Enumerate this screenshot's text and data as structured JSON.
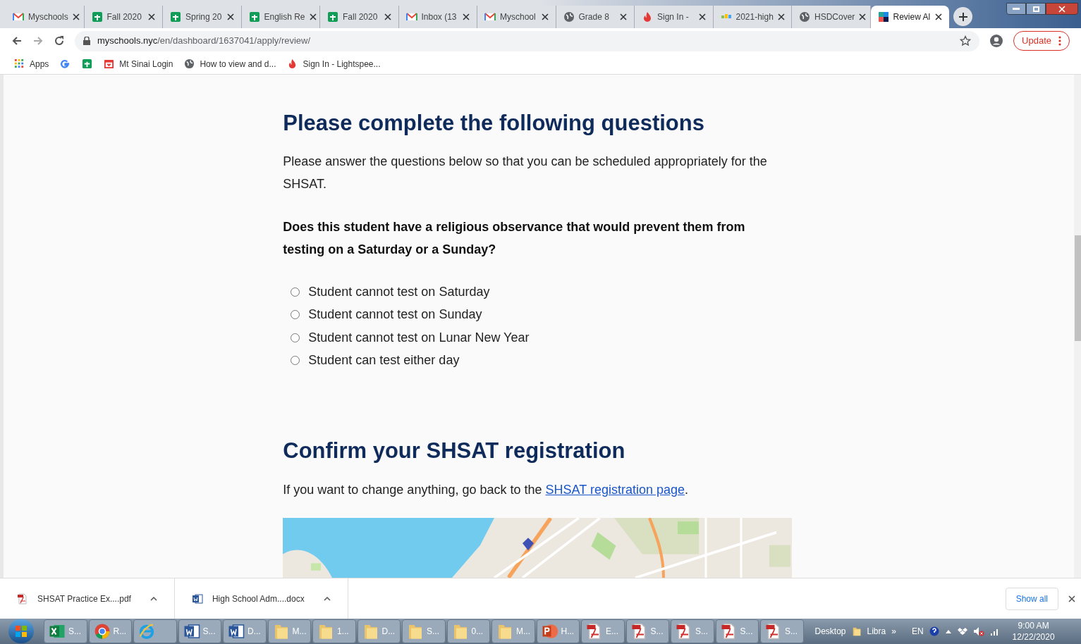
{
  "tabs": [
    {
      "kind": "gmail",
      "label": "Myschools",
      "selected": false
    },
    {
      "kind": "sheets",
      "label": "Fall 2020",
      "selected": false
    },
    {
      "kind": "sheets",
      "label": "Spring 20",
      "selected": false
    },
    {
      "kind": "sheets",
      "label": "English Re",
      "selected": false
    },
    {
      "kind": "sheets",
      "label": "Fall 2020",
      "selected": false
    },
    {
      "kind": "gmail",
      "label": "Inbox (13",
      "selected": false
    },
    {
      "kind": "gmail",
      "label": "Myschool",
      "selected": false
    },
    {
      "kind": "globe",
      "label": "Grade 8",
      "selected": false
    },
    {
      "kind": "flame",
      "label": "Sign In -",
      "selected": false
    },
    {
      "kind": "chart",
      "label": "2021-high",
      "selected": false
    },
    {
      "kind": "globe",
      "label": "HSDCover",
      "selected": false
    },
    {
      "kind": "squares",
      "label": "Review Al",
      "selected": true
    }
  ],
  "address_bar": {
    "domain": "myschools.nyc",
    "path": "/en/dashboard/1637041/apply/review/"
  },
  "update_button": "Update",
  "bookmarks": [
    {
      "kind": "apps",
      "label": "Apps"
    },
    {
      "kind": "google"
    },
    {
      "kind": "sheets"
    },
    {
      "kind": "calendar",
      "label": "Mt Sinai Login"
    },
    {
      "kind": "globe",
      "label": "How to view and d..."
    },
    {
      "kind": "flame",
      "label": "Sign In - Lightspee..."
    }
  ],
  "questions": {
    "heading": "Please complete the following questions",
    "intro": "Please answer the questions below so that you can be scheduled appropriately for the SHSAT.",
    "question": "Does this student have a religious observance that would prevent them from testing on a Saturday or a Sunday?",
    "options": [
      {
        "label": "Student cannot test on Saturday",
        "selected": false
      },
      {
        "label": "Student cannot test on Sunday",
        "selected": false
      },
      {
        "label": "Student cannot test on Lunar New Year",
        "selected": false
      },
      {
        "label": "Student can test either day",
        "selected": false
      }
    ]
  },
  "confirm": {
    "heading": "Confirm your SHSAT registration",
    "text_before": "If you want to change anything, go back to the",
    "link": "SHSAT registration page",
    "text_after": "."
  },
  "downloads": [
    {
      "kind": "pdf",
      "label": "SHSAT Practice Ex....pdf"
    },
    {
      "kind": "word",
      "label": "High School Adm....docx"
    }
  ],
  "show_all": "Show all",
  "taskbar": {
    "items": [
      {
        "kind": "excel",
        "label": "S..."
      },
      {
        "kind": "chrome",
        "label": "R..."
      },
      {
        "kind": "ie"
      },
      {
        "kind": "word",
        "label": "S..."
      },
      {
        "kind": "word",
        "label": "D..."
      },
      {
        "kind": "folder",
        "label": "M..."
      },
      {
        "kind": "folder",
        "label": "1..."
      },
      {
        "kind": "folder",
        "label": "D..."
      },
      {
        "kind": "folder",
        "label": "S..."
      },
      {
        "kind": "folder",
        "label": "0..."
      },
      {
        "kind": "folder",
        "label": "M..."
      },
      {
        "kind": "ppt",
        "label": "H..."
      },
      {
        "kind": "pdf",
        "label": "E..."
      },
      {
        "kind": "pdf",
        "label": "S..."
      },
      {
        "kind": "pdf",
        "label": "S..."
      },
      {
        "kind": "pdf",
        "label": "S..."
      },
      {
        "kind": "pdf",
        "label": "S..."
      }
    ],
    "desktop": "Desktop",
    "libra": "Libra",
    "chevron": "»",
    "lang": "EN",
    "time": "9:00 AM",
    "date": "12/22/2020"
  }
}
